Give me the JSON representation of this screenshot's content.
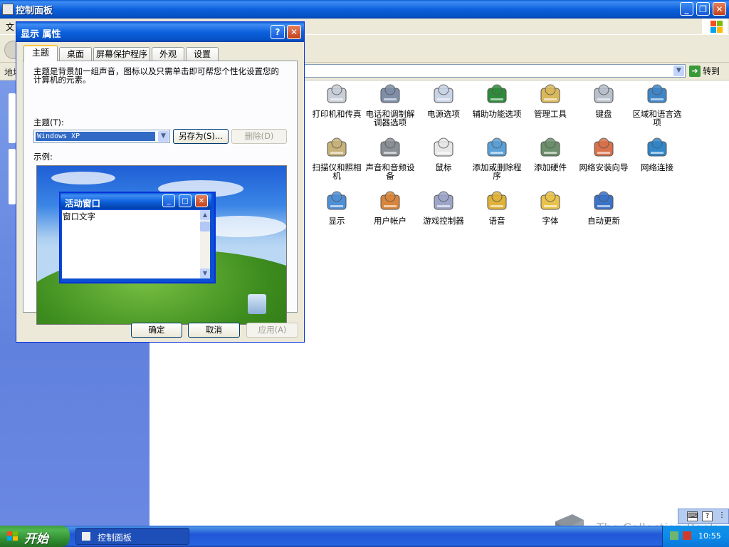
{
  "window": {
    "title": "控制面板"
  },
  "menubar": {
    "file": "文"
  },
  "address": {
    "label": "地址",
    "go_label": "转到"
  },
  "control_panel_items": [
    {
      "label": "打印机和传真",
      "icon": "printer-fax-icon"
    },
    {
      "label": "电话和调制解调器选项",
      "icon": "phone-modem-icon"
    },
    {
      "label": "电源选项",
      "icon": "power-options-icon"
    },
    {
      "label": "辅助功能选项",
      "icon": "accessibility-icon"
    },
    {
      "label": "管理工具",
      "icon": "admin-tools-icon"
    },
    {
      "label": "键盘",
      "icon": "keyboard-icon"
    },
    {
      "label": "区域和语言选项",
      "icon": "globe-icon"
    },
    {
      "label": "扫描仪和照相机",
      "icon": "scanner-camera-icon"
    },
    {
      "label": "声音和音频设备",
      "icon": "speaker-icon"
    },
    {
      "label": "鼠标",
      "icon": "mouse-icon"
    },
    {
      "label": "添加或删除程序",
      "icon": "add-remove-programs-icon"
    },
    {
      "label": "添加硬件",
      "icon": "add-hardware-icon"
    },
    {
      "label": "网络安装向导",
      "icon": "network-setup-icon"
    },
    {
      "label": "网络连接",
      "icon": "network-connections-icon"
    },
    {
      "label": "显示",
      "icon": "display-icon"
    },
    {
      "label": "用户帐户",
      "icon": "user-accounts-icon"
    },
    {
      "label": "游戏控制器",
      "icon": "game-controller-icon"
    },
    {
      "label": "语音",
      "icon": "speech-icon"
    },
    {
      "label": "字体",
      "icon": "fonts-folder-icon"
    },
    {
      "label": "自动更新",
      "icon": "windows-update-icon"
    }
  ],
  "dialog": {
    "title": "显示 属性",
    "help_glyph": "?",
    "close_glyph": "✕",
    "tabs": [
      {
        "label": "主题",
        "active": true
      },
      {
        "label": "桌面",
        "active": false
      },
      {
        "label": "屏幕保护程序",
        "active": false
      },
      {
        "label": "外观",
        "active": false
      },
      {
        "label": "设置",
        "active": false
      }
    ],
    "description": "主题是背景加一组声音，图标以及只需单击即可帮您个性化设置您的计算机的元素。",
    "theme_label": "主题(T):",
    "theme_value": "Windows XP",
    "save_as_label": "另存为(S)...",
    "delete_label": "删除(D)",
    "sample_label": "示例:",
    "preview": {
      "window_title": "活动窗口",
      "window_text": "窗口文字"
    },
    "ok_label": "确定",
    "cancel_label": "取消",
    "apply_label": "应用(A)"
  },
  "taskbar": {
    "start_label": "开始",
    "task_label": "控制面板",
    "clock": "10:55"
  },
  "watermark": "The Collection Book",
  "colors": {
    "title_blue": "#0550c4",
    "start_green": "#3c9b3c",
    "side_panel": "#6181de",
    "dialog_face": "#ece9d8"
  }
}
